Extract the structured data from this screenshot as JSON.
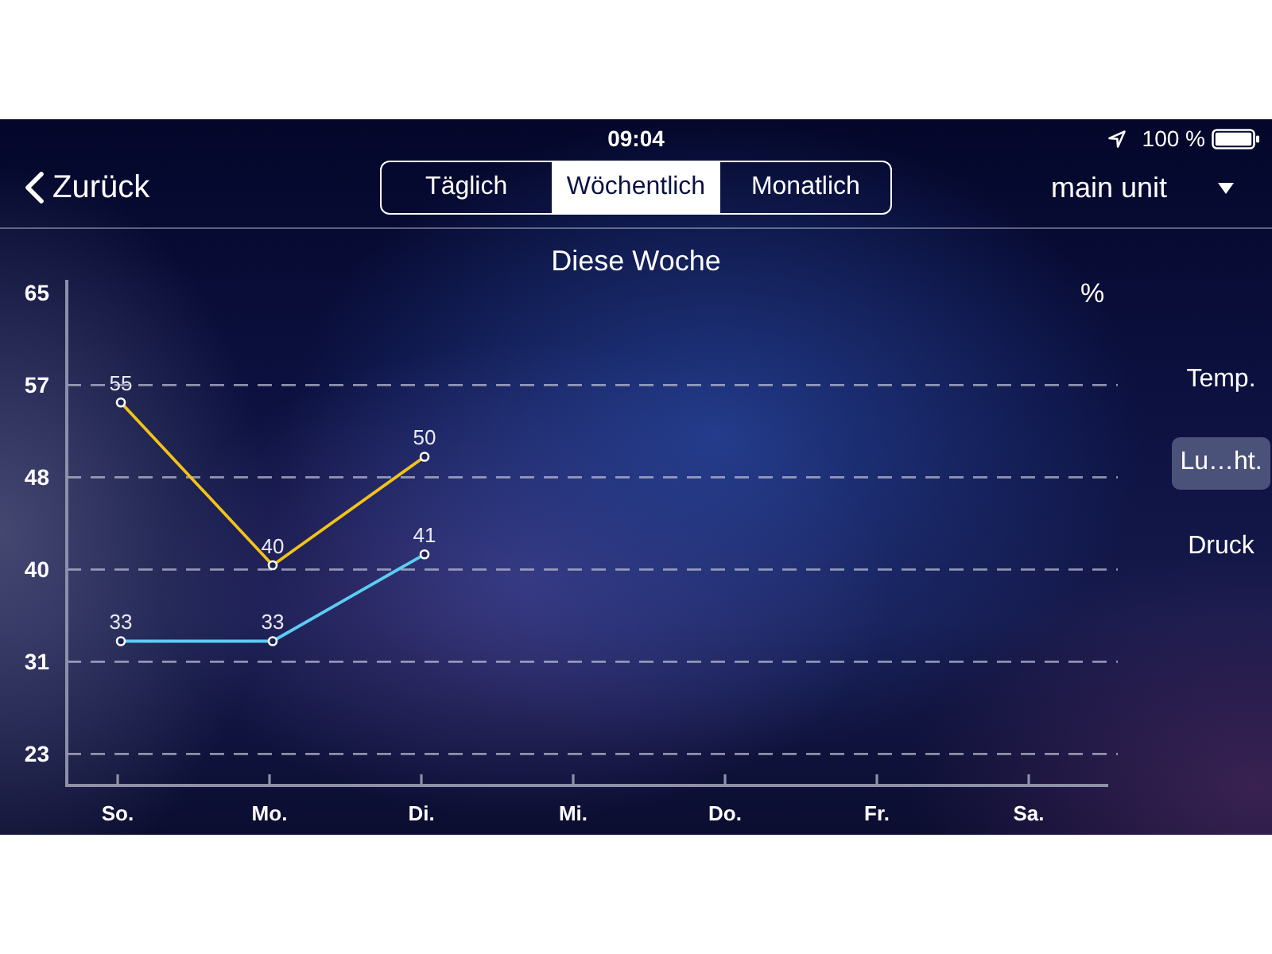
{
  "status_bar": {
    "time": "09:04",
    "battery_text": "100 %"
  },
  "nav_bar": {
    "back": "Zurück",
    "tabs": [
      {
        "label": "Täglich",
        "selected": false
      },
      {
        "label": "Wöchentlich",
        "selected": true
      },
      {
        "label": "Monatlich",
        "selected": false
      }
    ],
    "unit_selector": "main unit"
  },
  "chart": {
    "chart_data": {
      "type": "line",
      "title": "Diese Woche",
      "ylabel": "%",
      "categories": [
        "So.",
        "Mo.",
        "Di.",
        "Mi.",
        "Do.",
        "Fr.",
        "Sa."
      ],
      "series": [
        {
          "color": "#f2c318",
          "marker": "circle",
          "values": [
            55,
            40,
            50,
            null,
            null,
            null,
            null
          ]
        },
        {
          "color": "#5ccdf2",
          "marker": "circle",
          "values": [
            33,
            33,
            41,
            null,
            null,
            null,
            null
          ]
        }
      ],
      "ylim": [
        19.7,
        66.3
      ],
      "yticks": [
        {
          "value": 22.6,
          "label": "23"
        },
        {
          "value": 31.1,
          "label": "31"
        },
        {
          "value": 39.6,
          "label": "40"
        },
        {
          "value": 48.1,
          "label": "48"
        },
        {
          "value": 56.6,
          "label": "57"
        },
        {
          "value": 65.1,
          "label": "65"
        }
      ],
      "grid": true,
      "data_labels": true
    }
  },
  "measures": [
    {
      "label": "Temp.",
      "selected": false
    },
    {
      "label": "Lu…ht.",
      "selected": true
    },
    {
      "label": "Druck",
      "selected": false
    }
  ]
}
